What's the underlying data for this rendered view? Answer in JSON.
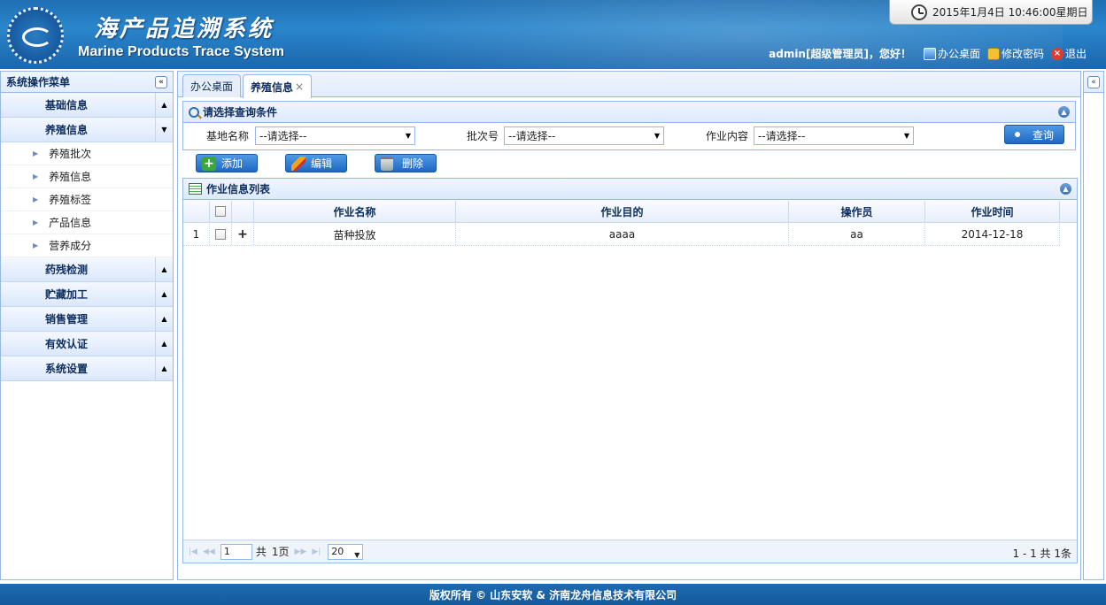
{
  "header": {
    "title_cn": "海产品追溯系统",
    "title_en": "Marine Products Trace System",
    "datetime": "2015年1月4日  10:46:00星期日",
    "greeting": "admin[超级管理员]，您好！",
    "links": {
      "desktop": "办公桌面",
      "change_password": "修改密码",
      "logout": "退出"
    },
    "icons": [
      "clock-icon",
      "desk-icon",
      "lock-icon",
      "exit-icon"
    ]
  },
  "sidebar": {
    "title": "系统操作菜单",
    "sections": [
      {
        "label": "基础信息",
        "toggle": "▲"
      },
      {
        "label": "养殖信息",
        "toggle": "▼",
        "items": [
          "养殖批次",
          "养殖信息",
          "养殖标签",
          "产品信息",
          "营养成分"
        ]
      },
      {
        "label": "药残检测",
        "toggle": "▲"
      },
      {
        "label": "贮藏加工",
        "toggle": "▲"
      },
      {
        "label": "销售管理",
        "toggle": "▲"
      },
      {
        "label": "有效认证",
        "toggle": "▲"
      },
      {
        "label": "系统设置",
        "toggle": "▲"
      }
    ]
  },
  "tabs": [
    {
      "label": "办公桌面"
    },
    {
      "label": "养殖信息",
      "close": "×"
    }
  ],
  "query": {
    "title": "请选择查询条件",
    "fields": [
      {
        "label": "基地名称",
        "value": "--请选择--"
      },
      {
        "label": "批次号",
        "value": "--请选择--"
      },
      {
        "label": "作业内容",
        "value": "--请选择--"
      }
    ],
    "search_label": "查询"
  },
  "toolbar": {
    "add": "添加",
    "edit": "编辑",
    "delete": "删除"
  },
  "grid": {
    "title": "作业信息列表",
    "columns": [
      "作业名称",
      "作业目的",
      "操作员",
      "作业时间"
    ],
    "rows": [
      {
        "index": "1",
        "expand": "+",
        "name": "苗种投放",
        "purpose": "aaaa",
        "operator": "aa",
        "time": "2014-12-18"
      }
    ]
  },
  "pager": {
    "page": "1",
    "total_prefix": "共",
    "total_pages": "1页",
    "page_size": "20",
    "info": "1 - 1    共 1条"
  },
  "footer": {
    "text": "版权所有  ©  山东安软  & 济南龙舟信息技术有限公司"
  },
  "colors": {
    "header_blue": "#1f6fb3",
    "border_blue": "#95b8e7",
    "button_blue": "#1e68c3"
  }
}
